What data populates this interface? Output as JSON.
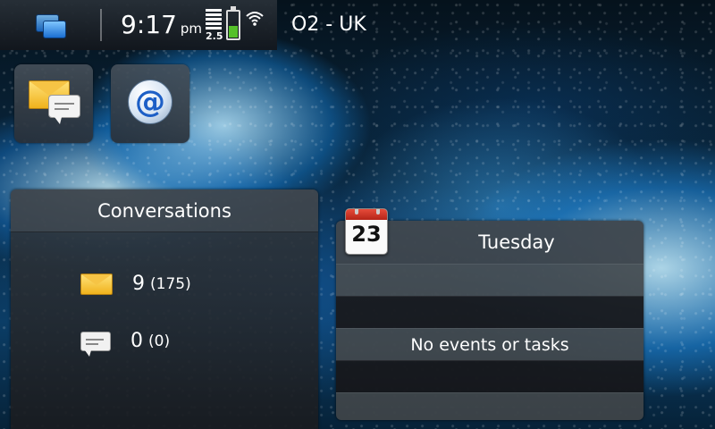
{
  "status_bar": {
    "time": "9:17",
    "ampm": "pm",
    "network_type": "2.5",
    "operator": "O2 - UK",
    "battery_level": 0.45,
    "icons": [
      "task-switcher-icon",
      "signal-strength-icon",
      "battery-icon",
      "wifi-icon"
    ]
  },
  "shortcuts": [
    {
      "name": "messaging",
      "icon": "envelope-chat-icon"
    },
    {
      "name": "email",
      "icon": "at-sign-icon",
      "glyph": "@"
    }
  ],
  "conversations_widget": {
    "title": "Conversations",
    "rows": [
      {
        "icon": "envelope-icon",
        "count": "9",
        "total": "(175)"
      },
      {
        "icon": "chat-bubble-icon",
        "count": "0",
        "total": "(0)"
      }
    ]
  },
  "calendar_widget": {
    "day_number": "23",
    "weekday": "Tuesday",
    "empty_text": "No events or tasks"
  },
  "colors": {
    "accent_blue": "#1b6fd1",
    "battery_green": "#55c02a",
    "envelope_yellow": "#f0b21c",
    "calendar_red": "#c93324"
  }
}
